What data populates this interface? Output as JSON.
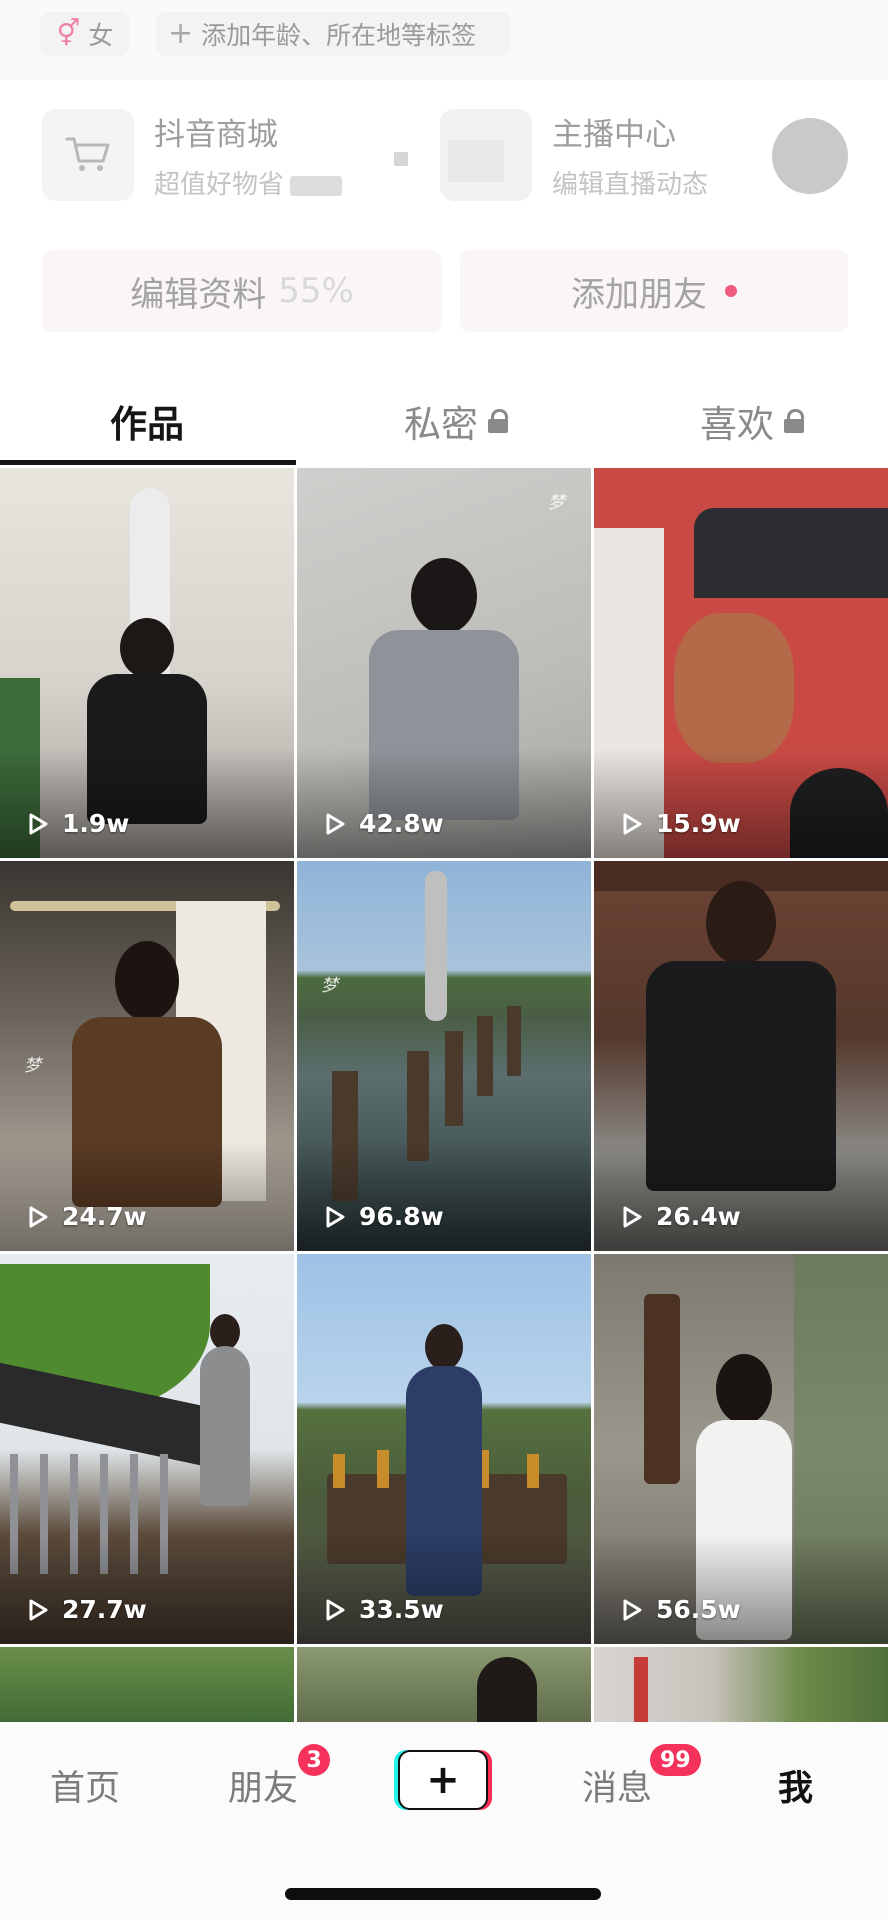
{
  "profile_tags": {
    "gender_symbol": "⚥",
    "gender": "女",
    "add_tag_plus": "+",
    "add_tag_label": "添加年龄、所在地等标签"
  },
  "services": {
    "mall_title": "抖音商城",
    "mall_subtitle": "超值好物省",
    "anchor_title": "主播中心",
    "anchor_subtitle": "编辑直播动态"
  },
  "actions": {
    "edit_profile": "编辑资料",
    "edit_progress": "55%",
    "add_friends": "添加朋友"
  },
  "tabs": {
    "works": "作品",
    "private": "私密",
    "likes": "喜欢"
  },
  "videos": [
    {
      "views": "1.9w"
    },
    {
      "views": "42.8w",
      "watermark": "梦"
    },
    {
      "views": "15.9w"
    },
    {
      "views": "24.7w",
      "watermark": "梦"
    },
    {
      "views": "96.8w",
      "watermark": "梦"
    },
    {
      "views": "26.4w"
    },
    {
      "views": "27.7w"
    },
    {
      "views": "33.5w"
    },
    {
      "views": "56.5w"
    }
  ],
  "bottom_nav": {
    "home": "首页",
    "friends": "朋友",
    "friends_badge": "3",
    "create": "+",
    "messages": "消息",
    "messages_badge": "99",
    "me": "我"
  },
  "colors": {
    "accent_red": "#f5325c",
    "tiktok_cyan": "#25f4ee",
    "tiktok_pink": "#fe2c55",
    "gender_pink": "#f07fa5"
  },
  "icons": {
    "mall": "shopping-cart-icon",
    "lock": "lock-icon",
    "play": "play-icon"
  }
}
